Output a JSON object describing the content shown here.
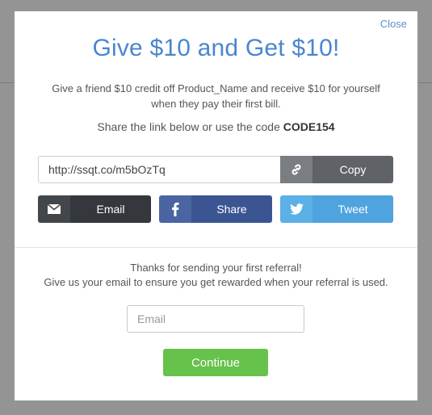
{
  "modal": {
    "close_label": "Close",
    "headline": "Give $10 and Get $10!",
    "subtext": "Give a friend $10 credit off Product_Name and receive $10 for yourself when they pay their first bill.",
    "code_prefix": "Share the link below or use the code",
    "code": "CODE154"
  },
  "share": {
    "link_value": "http://ssqt.co/m5bOzTq",
    "copy_label": "Copy",
    "copy_icon": "link-icon",
    "email_label": "Email",
    "email_icon": "envelope-icon",
    "facebook_label": "Share",
    "facebook_icon": "facebook-icon",
    "twitter_label": "Tweet",
    "twitter_icon": "twitter-icon"
  },
  "followup": {
    "thanks_line1": "Thanks for sending your first referral!",
    "thanks_line2": "Give us your email to ensure you get rewarded when your referral is used.",
    "email_placeholder": "Email",
    "continue_label": "Continue"
  },
  "colors": {
    "headline": "#4a86d0",
    "facebook": "#3b5593",
    "twitter": "#4fa3df",
    "continue": "#66c24a"
  }
}
